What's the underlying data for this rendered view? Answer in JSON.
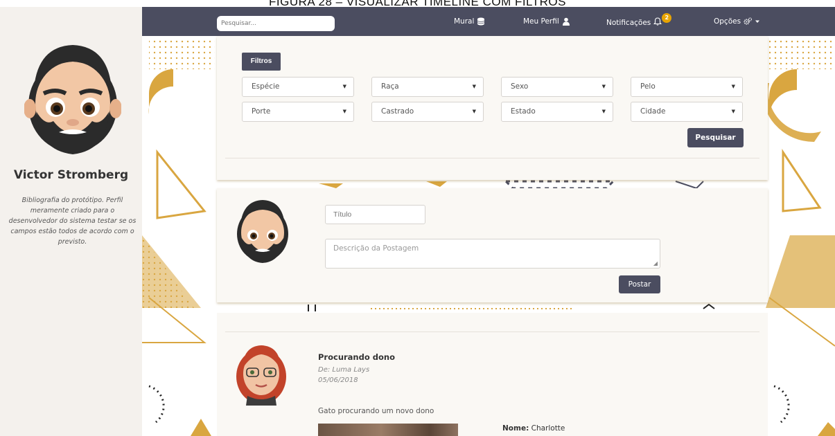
{
  "caption": "FIGURA 28 – VISUALIZAR TIMELINE COM FILTROS",
  "navbar": {
    "search_placeholder": "Pesquisar...",
    "mural": "Mural",
    "meu_perfil": "Meu Perfil",
    "notificacoes": "Notificações",
    "notification_count": "2",
    "opcoes": "Opções",
    "icons": [
      "database-icon",
      "user-icon",
      "bell-icon",
      "cogs-icon",
      "caret-down-icon"
    ]
  },
  "profile": {
    "name": "Victor Stromberg",
    "bio": "Bibliografia do protótipo. Perfil meramente criado para o desenvolvedor do sistema testar se os campos estão todos de acordo com o previsto."
  },
  "filters": {
    "toggle_label": "Filtros",
    "selects": [
      "Espécie",
      "Raça",
      "Sexo",
      "Pelo",
      "Porte",
      "Castrado",
      "Estado",
      "Cidade"
    ],
    "search_button": "Pesquisar"
  },
  "new_post": {
    "title_placeholder": "Título",
    "description_placeholder": "Descrição da Postagem",
    "submit_label": "Postar"
  },
  "feed": {
    "post_title": "Procurando dono",
    "author": "De: Luma Lays",
    "date": "05/06/2018",
    "description": "Gato procurando um novo dono",
    "pet_name_label": "Nome:",
    "pet_name_value": "Charlotte"
  },
  "colors": {
    "navbar": "#4b4d60",
    "accent_gold": "#d9a640",
    "sidebar": "#f4f1ed",
    "card": "#faf8f4"
  }
}
